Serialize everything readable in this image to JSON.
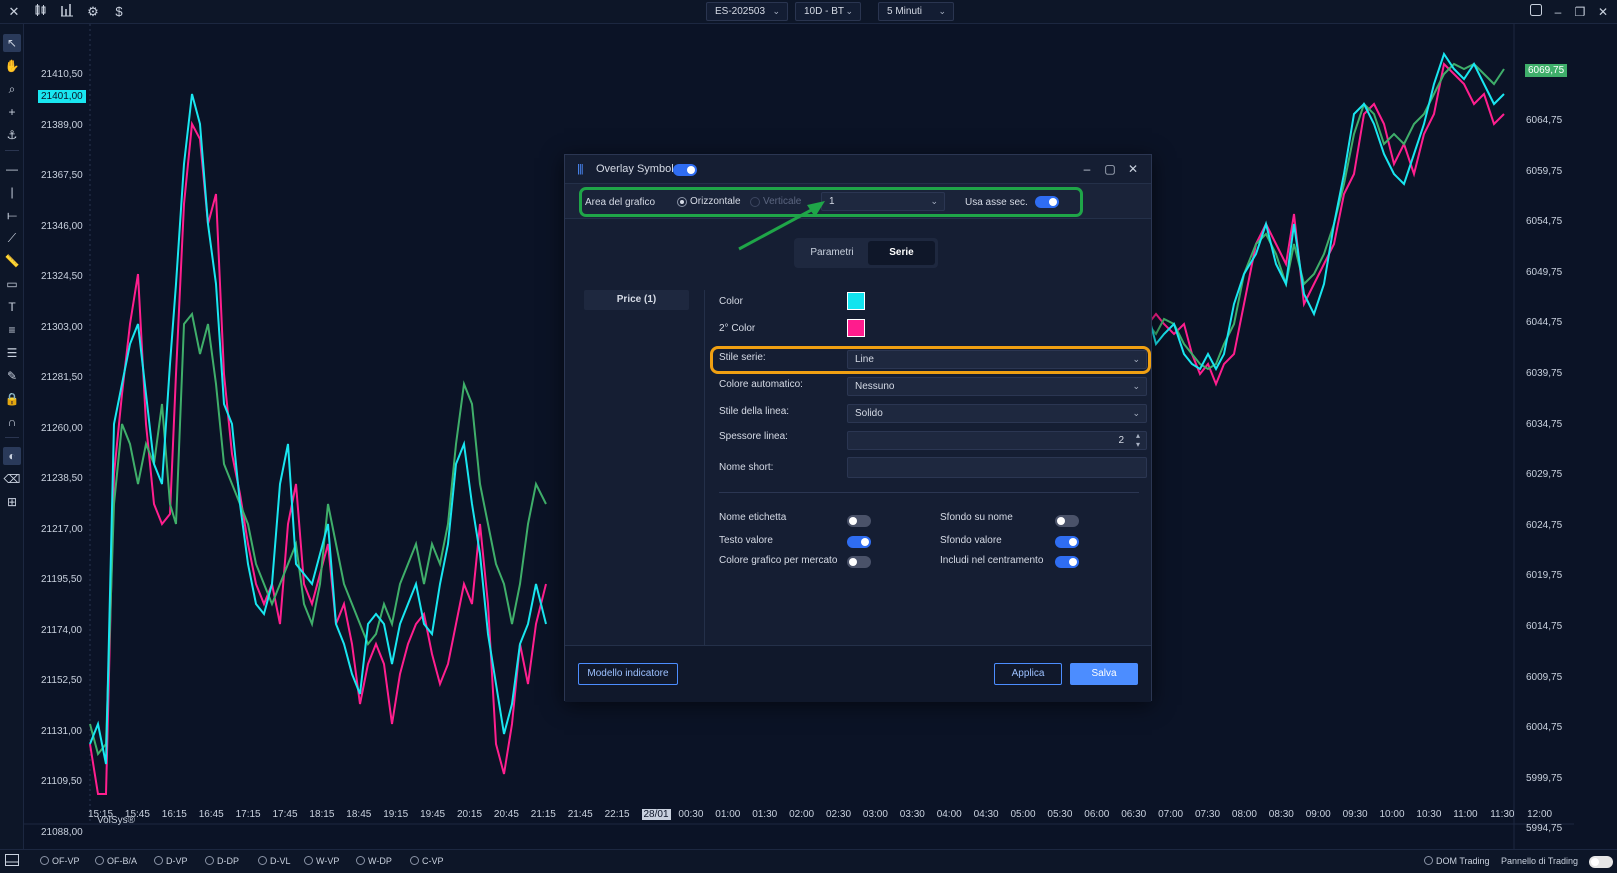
{
  "topbar": {
    "icons": [
      "close-icon",
      "candles-icon",
      "bars-icon",
      "gear-icon",
      "dollar-icon"
    ],
    "symbol": "ES-202503",
    "range": "10D - BT",
    "timeframe": "5 Minuti"
  },
  "chart": {
    "watermark": "VolSys®",
    "left_axis": [
      "21410,50",
      "21389,00",
      "21367,50",
      "21346,00",
      "21324,50",
      "21303,00",
      "21281,50",
      "21260,00",
      "21238,50",
      "21217,00",
      "21195,50",
      "21174,00",
      "21152,50",
      "21131,00",
      "21109,50",
      "21088,00"
    ],
    "left_current": "21401,00",
    "right_axis": [
      "6064,75",
      "6059,75",
      "6054,75",
      "6049,75",
      "6044,75",
      "6039,75",
      "6034,75",
      "6029,75",
      "6024,75",
      "6019,75",
      "6014,75",
      "6009,75",
      "6004,75",
      "5999,75",
      "5994,75"
    ],
    "right_current": "6069,75",
    "time_axis": [
      "15:15",
      "15:45",
      "16:15",
      "16:45",
      "17:15",
      "17:45",
      "18:15",
      "18:45",
      "19:15",
      "19:45",
      "20:15",
      "20:45",
      "21:15",
      "21:45",
      "22:15",
      "28/01",
      "00:30",
      "01:00",
      "01:30",
      "02:00",
      "02:30",
      "03:00",
      "03:30",
      "04:00",
      "04:30",
      "05:00",
      "05:30",
      "06:00",
      "06:30",
      "07:00",
      "07:30",
      "08:00",
      "08:30",
      "09:00",
      "09:30",
      "10:00",
      "10:30",
      "11:00",
      "11:30",
      "12:00"
    ],
    "colors": {
      "primary": "#19e6f0",
      "secondary": "#ff1f8e",
      "current_left": "#19e6f0",
      "current_right": "#3fae6a"
    }
  },
  "bottombar": {
    "items": [
      "OF-VP",
      "OF-B/A",
      "D-VP",
      "D-DP",
      "D-VL",
      "W-VP",
      "W-DP",
      "C-VP"
    ],
    "dom_trading": "DOM Trading",
    "trading_panel": "Pannello di Trading"
  },
  "dialog": {
    "title": "Overlay Symbol",
    "title_toggle_on": true,
    "area_label": "Area del grafico",
    "orientation_horizontal": "Orizzontale",
    "orientation_vertical": "Verticale",
    "area_value": "1",
    "secondary_axis_label": "Usa asse sec.",
    "tabs": [
      "Parametri",
      "Serie"
    ],
    "active_tab": "Serie",
    "series_item": "Price (1)",
    "fields": {
      "color_label": "Color",
      "color_value": "#12e4ef",
      "color2_label": "2° Color",
      "color2_value": "#ff1c8d",
      "series_style_label": "Stile serie:",
      "series_style_value": "Line",
      "auto_color_label": "Colore automatico:",
      "auto_color_value": "Nessuno",
      "line_style_label": "Stile della linea:",
      "line_style_value": "Solido",
      "line_width_label": "Spessore linea:",
      "line_width_value": "2",
      "short_name_label": "Nome short:",
      "short_name_value": ""
    },
    "toggles": {
      "label_name": "Nome etichetta",
      "value_text": "Testo valore",
      "market_color": "Colore grafico per mercato",
      "name_background": "Sfondo su nome",
      "value_background": "Sfondo valore",
      "include_centering": "Includi nel centramento"
    },
    "toggle_states": [
      false,
      true,
      false,
      false,
      true,
      true
    ],
    "footer": {
      "template_button": "Modello indicatore",
      "apply_button": "Applica",
      "save_button": "Salva"
    },
    "highlight_colors": {
      "area_row": "#1fa548",
      "series_style": "#f0a012"
    }
  }
}
